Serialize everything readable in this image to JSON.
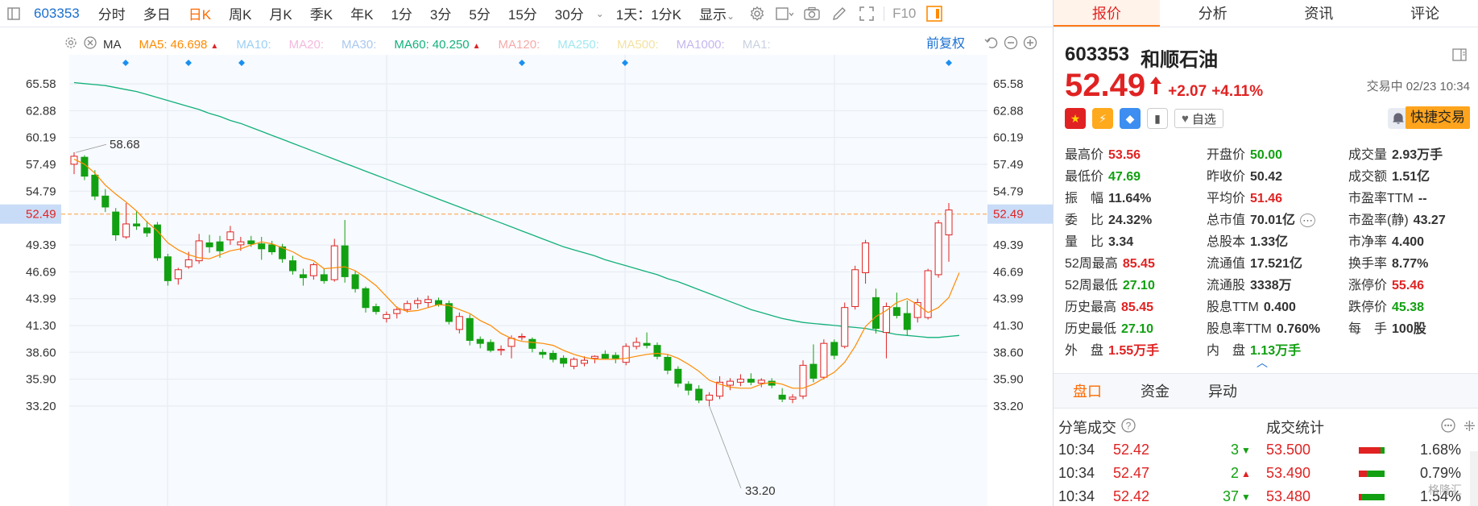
{
  "toolbar": {
    "code": "603353",
    "periods": [
      "分时",
      "多日",
      "日K",
      "周K",
      "月K",
      "季K",
      "年K",
      "1分",
      "3分",
      "5分",
      "15分",
      "30分"
    ],
    "active_period": "日K",
    "range_select": "1天：1分K",
    "display": "显示",
    "f10": "F10"
  },
  "ma_bar": {
    "indicator": "MA",
    "items": [
      {
        "label": "MA5:",
        "value": "46.698",
        "color": "#ff8a00",
        "up": true
      },
      {
        "label": "MA10:",
        "value": "",
        "color": "#9bd0f5",
        "up": false
      },
      {
        "label": "MA20:",
        "value": "",
        "color": "#f5b8de",
        "up": false
      },
      {
        "label": "MA30:",
        "value": "",
        "color": "#a9c8f0",
        "up": false
      },
      {
        "label": "MA60:",
        "value": "40.250",
        "color": "#12b07a",
        "up": true
      },
      {
        "label": "MA120:",
        "value": "",
        "color": "#f7aaaa",
        "up": false
      },
      {
        "label": "MA250:",
        "value": "",
        "color": "#9fe8f0",
        "up": false
      },
      {
        "label": "MA500:",
        "value": "",
        "color": "#f3e2a0",
        "up": false
      },
      {
        "label": "MA1000:",
        "value": "",
        "color": "#c6b6ef",
        "up": false
      },
      {
        "label": "MA1:",
        "value": "",
        "color": "#c8d2e0",
        "up": false
      }
    ],
    "adjust": "前复权"
  },
  "chart_data": {
    "type": "candlestick",
    "y_ticks": [
      65.58,
      62.88,
      60.19,
      57.49,
      54.79,
      52.49,
      49.39,
      46.69,
      43.99,
      41.3,
      38.6,
      35.9,
      33.2
    ],
    "current_price_line": 52.49,
    "high_label": "58.68",
    "low_label": "33.20",
    "candles": [
      {
        "o": 57.5,
        "h": 58.7,
        "l": 56.5,
        "c": 58.3
      },
      {
        "o": 58.2,
        "h": 58.4,
        "l": 55.9,
        "c": 56.3
      },
      {
        "o": 56.4,
        "h": 56.9,
        "l": 53.9,
        "c": 54.3
      },
      {
        "o": 54.3,
        "h": 55.0,
        "l": 52.7,
        "c": 53.2
      },
      {
        "o": 52.7,
        "h": 53.1,
        "l": 49.8,
        "c": 50.4
      },
      {
        "o": 50.2,
        "h": 53.6,
        "l": 50.0,
        "c": 51.5
      },
      {
        "o": 51.5,
        "h": 52.8,
        "l": 50.9,
        "c": 51.3
      },
      {
        "o": 51.1,
        "h": 51.8,
        "l": 50.2,
        "c": 50.6
      },
      {
        "o": 51.4,
        "h": 51.7,
        "l": 47.8,
        "c": 48.1
      },
      {
        "o": 48.2,
        "h": 48.5,
        "l": 45.3,
        "c": 45.8
      },
      {
        "o": 46.0,
        "h": 47.1,
        "l": 45.4,
        "c": 46.9
      },
      {
        "o": 47.2,
        "h": 48.7,
        "l": 47.0,
        "c": 47.9
      },
      {
        "o": 47.8,
        "h": 50.5,
        "l": 47.5,
        "c": 49.8
      },
      {
        "o": 49.6,
        "h": 50.4,
        "l": 48.6,
        "c": 49.2
      },
      {
        "o": 49.7,
        "h": 50.3,
        "l": 48.1,
        "c": 48.8
      },
      {
        "o": 49.9,
        "h": 51.3,
        "l": 49.4,
        "c": 50.7
      },
      {
        "o": 49.4,
        "h": 50.2,
        "l": 48.8,
        "c": 49.7
      },
      {
        "o": 49.8,
        "h": 50.3,
        "l": 49.2,
        "c": 49.5
      },
      {
        "o": 49.5,
        "h": 50.2,
        "l": 47.9,
        "c": 49.0
      },
      {
        "o": 49.4,
        "h": 49.8,
        "l": 48.4,
        "c": 48.7
      },
      {
        "o": 49.2,
        "h": 49.5,
        "l": 47.6,
        "c": 48.0
      },
      {
        "o": 47.8,
        "h": 48.3,
        "l": 46.4,
        "c": 46.8
      },
      {
        "o": 46.4,
        "h": 47.0,
        "l": 45.3,
        "c": 46.1
      },
      {
        "o": 46.3,
        "h": 47.6,
        "l": 45.9,
        "c": 47.4
      },
      {
        "o": 46.4,
        "h": 47.0,
        "l": 45.5,
        "c": 45.8
      },
      {
        "o": 45.9,
        "h": 50.0,
        "l": 45.7,
        "c": 49.3
      },
      {
        "o": 49.3,
        "h": 51.9,
        "l": 45.6,
        "c": 46.2
      },
      {
        "o": 46.4,
        "h": 46.8,
        "l": 44.6,
        "c": 45.0
      },
      {
        "o": 45.0,
        "h": 45.2,
        "l": 42.6,
        "c": 43.1
      },
      {
        "o": 43.2,
        "h": 43.5,
        "l": 42.4,
        "c": 42.7
      },
      {
        "o": 42.0,
        "h": 42.7,
        "l": 41.6,
        "c": 42.4
      },
      {
        "o": 42.5,
        "h": 43.2,
        "l": 42.0,
        "c": 42.9
      },
      {
        "o": 42.9,
        "h": 43.8,
        "l": 42.6,
        "c": 43.5
      },
      {
        "o": 43.5,
        "h": 44.1,
        "l": 43.0,
        "c": 43.8
      },
      {
        "o": 43.6,
        "h": 44.3,
        "l": 43.1,
        "c": 43.9
      },
      {
        "o": 43.8,
        "h": 44.1,
        "l": 43.2,
        "c": 43.4
      },
      {
        "o": 43.5,
        "h": 43.8,
        "l": 41.4,
        "c": 41.7
      },
      {
        "o": 40.9,
        "h": 42.6,
        "l": 40.5,
        "c": 42.2
      },
      {
        "o": 42.0,
        "h": 42.4,
        "l": 39.3,
        "c": 39.8
      },
      {
        "o": 39.9,
        "h": 40.2,
        "l": 39.0,
        "c": 39.5
      },
      {
        "o": 39.6,
        "h": 39.9,
        "l": 38.6,
        "c": 38.8
      },
      {
        "o": 38.8,
        "h": 39.3,
        "l": 38.3,
        "c": 38.9
      },
      {
        "o": 39.2,
        "h": 40.3,
        "l": 38.0,
        "c": 40.0
      },
      {
        "o": 40.1,
        "h": 40.5,
        "l": 39.8,
        "c": 40.2
      },
      {
        "o": 39.9,
        "h": 40.1,
        "l": 38.6,
        "c": 39.0
      },
      {
        "o": 38.6,
        "h": 38.9,
        "l": 38.0,
        "c": 38.4
      },
      {
        "o": 38.5,
        "h": 38.8,
        "l": 37.6,
        "c": 37.9
      },
      {
        "o": 38.0,
        "h": 38.3,
        "l": 37.1,
        "c": 37.5
      },
      {
        "o": 37.2,
        "h": 38.1,
        "l": 36.9,
        "c": 37.9
      },
      {
        "o": 37.5,
        "h": 38.2,
        "l": 37.2,
        "c": 37.8
      },
      {
        "o": 38.0,
        "h": 38.3,
        "l": 37.5,
        "c": 38.2
      },
      {
        "o": 38.4,
        "h": 38.8,
        "l": 37.9,
        "c": 38.0
      },
      {
        "o": 38.3,
        "h": 38.6,
        "l": 37.5,
        "c": 38.0
      },
      {
        "o": 37.6,
        "h": 39.5,
        "l": 37.3,
        "c": 39.2
      },
      {
        "o": 39.2,
        "h": 40.1,
        "l": 38.9,
        "c": 39.6
      },
      {
        "o": 39.5,
        "h": 40.6,
        "l": 39.0,
        "c": 39.3
      },
      {
        "o": 39.3,
        "h": 39.6,
        "l": 37.9,
        "c": 38.2
      },
      {
        "o": 38.1,
        "h": 38.4,
        "l": 36.4,
        "c": 36.8
      },
      {
        "o": 36.9,
        "h": 37.2,
        "l": 35.1,
        "c": 35.5
      },
      {
        "o": 35.4,
        "h": 35.7,
        "l": 34.3,
        "c": 34.8
      },
      {
        "o": 34.9,
        "h": 35.3,
        "l": 33.5,
        "c": 33.8
      },
      {
        "o": 33.8,
        "h": 34.6,
        "l": 33.2,
        "c": 34.3
      },
      {
        "o": 34.2,
        "h": 36.2,
        "l": 33.9,
        "c": 35.6
      },
      {
        "o": 35.3,
        "h": 36.0,
        "l": 34.8,
        "c": 35.7
      },
      {
        "o": 35.6,
        "h": 36.4,
        "l": 35.2,
        "c": 35.9
      },
      {
        "o": 35.9,
        "h": 36.5,
        "l": 35.3,
        "c": 35.6
      },
      {
        "o": 35.5,
        "h": 36.0,
        "l": 35.1,
        "c": 35.8
      },
      {
        "o": 35.7,
        "h": 36.0,
        "l": 35.0,
        "c": 35.3
      },
      {
        "o": 34.3,
        "h": 35.0,
        "l": 33.6,
        "c": 33.9
      },
      {
        "o": 33.9,
        "h": 34.4,
        "l": 33.5,
        "c": 34.1
      },
      {
        "o": 34.2,
        "h": 37.8,
        "l": 33.9,
        "c": 37.3
      },
      {
        "o": 37.4,
        "h": 39.4,
        "l": 35.6,
        "c": 36.0
      },
      {
        "o": 36.1,
        "h": 39.9,
        "l": 35.9,
        "c": 39.5
      },
      {
        "o": 39.6,
        "h": 39.9,
        "l": 37.9,
        "c": 38.3
      },
      {
        "o": 39.2,
        "h": 43.6,
        "l": 39.0,
        "c": 43.1
      },
      {
        "o": 43.2,
        "h": 47.3,
        "l": 42.9,
        "c": 46.9
      },
      {
        "o": 46.6,
        "h": 49.9,
        "l": 45.5,
        "c": 49.6
      },
      {
        "o": 44.1,
        "h": 45.0,
        "l": 40.5,
        "c": 41.0
      },
      {
        "o": 40.6,
        "h": 43.6,
        "l": 38.0,
        "c": 43.2
      },
      {
        "o": 43.1,
        "h": 44.6,
        "l": 42.0,
        "c": 42.3
      },
      {
        "o": 42.5,
        "h": 43.8,
        "l": 40.3,
        "c": 40.9
      },
      {
        "o": 42.1,
        "h": 44.0,
        "l": 41.6,
        "c": 43.6
      },
      {
        "o": 42.1,
        "h": 47.0,
        "l": 41.9,
        "c": 46.8
      },
      {
        "o": 46.4,
        "h": 51.9,
        "l": 46.1,
        "c": 51.6
      },
      {
        "o": 50.4,
        "h": 53.6,
        "l": 47.7,
        "c": 52.9
      }
    ],
    "ma5": [
      58.0,
      57.5,
      56.6,
      55.4,
      54.5,
      53.7,
      52.8,
      51.7,
      50.8,
      49.6,
      48.9,
      48.4,
      48.1,
      48.0,
      48.4,
      48.8,
      49.0,
      49.4,
      49.7,
      49.5,
      49.1,
      48.7,
      48.1,
      47.8,
      47.0,
      47.1,
      47.2,
      46.8,
      46.1,
      45.3,
      44.2,
      43.1,
      42.7,
      42.8,
      43.1,
      43.4,
      43.3,
      42.9,
      42.5,
      41.8,
      41.3,
      40.5,
      40.0,
      39.7,
      39.6,
      39.5,
      39.3,
      38.8,
      38.4,
      38.1,
      37.9,
      37.9,
      37.9,
      38.0,
      38.2,
      38.4,
      38.5,
      38.4,
      38.0,
      37.4,
      36.7,
      35.8,
      35.4,
      35.1,
      35.0,
      35.0,
      35.4,
      35.6,
      35.4,
      35.0,
      35.0,
      35.4,
      36.0,
      36.6,
      37.6,
      39.2,
      41.2,
      42.2,
      42.8,
      43.6,
      44.0,
      43.4,
      42.6,
      43.1,
      44.1,
      46.6
    ],
    "ma60": [
      65.7,
      65.6,
      65.5,
      65.4,
      65.2,
      65.0,
      64.8,
      64.5,
      64.2,
      63.9,
      63.6,
      63.3,
      63.0,
      62.6,
      62.3,
      61.9,
      61.6,
      61.2,
      60.8,
      60.4,
      60.0,
      59.6,
      59.2,
      58.8,
      58.4,
      58.0,
      57.6,
      57.2,
      56.8,
      56.4,
      56.0,
      55.6,
      55.2,
      54.8,
      54.4,
      54.0,
      53.6,
      53.2,
      52.8,
      52.4,
      52.0,
      51.6,
      51.2,
      50.8,
      50.4,
      50.0,
      49.6,
      49.2,
      48.9,
      48.6,
      48.3,
      47.9,
      47.6,
      47.3,
      47.0,
      46.7,
      46.4,
      46.0,
      45.7,
      45.3,
      44.9,
      44.5,
      44.1,
      43.7,
      43.3,
      42.9,
      42.6,
      42.3,
      42.0,
      41.8,
      41.6,
      41.5,
      41.4,
      41.3,
      41.2,
      41.1,
      41.0,
      40.8,
      40.6,
      40.4,
      40.3,
      40.2,
      40.1,
      40.1,
      40.2,
      40.3
    ]
  },
  "quote": {
    "tabs": [
      "报价",
      "分析",
      "资讯",
      "评论"
    ],
    "active_tab": "报价",
    "code": "603353",
    "name": "和顺石油",
    "price": "52.49",
    "change": "+2.07",
    "change_pct": "+4.11%",
    "trade_status": "交易中 02/23 10:34",
    "watch_label": "自选",
    "fast_trade": "快捷交易"
  },
  "stats": [
    [
      {
        "label": "最高价",
        "value": "53.56",
        "color": "red"
      },
      {
        "label": "开盘价",
        "value": "50.00",
        "color": "green"
      },
      {
        "label": "成交量",
        "value": "2.93万手",
        "color": "dark"
      }
    ],
    [
      {
        "label": "最低价",
        "value": "47.69",
        "color": "green"
      },
      {
        "label": "昨收价",
        "value": "50.42",
        "color": "dark"
      },
      {
        "label": "成交额",
        "value": "1.51亿",
        "color": "dark"
      }
    ],
    [
      {
        "label": "振　幅",
        "value": "11.64%",
        "color": "dark"
      },
      {
        "label": "平均价",
        "value": "51.46",
        "color": "red"
      },
      {
        "label": "市盈率TTM",
        "value": "--",
        "color": "dark"
      }
    ],
    [
      {
        "label": "委　比",
        "value": "24.32%",
        "color": "dark"
      },
      {
        "label": "总市值",
        "value": "70.01亿",
        "color": "dark"
      },
      {
        "label": "市盈率(静)",
        "value": "43.27",
        "color": "dark"
      }
    ],
    [
      {
        "label": "量　比",
        "value": "3.34",
        "color": "dark"
      },
      {
        "label": "总股本",
        "value": "1.33亿",
        "color": "dark"
      },
      {
        "label": "市净率",
        "value": "4.400",
        "color": "dark"
      }
    ],
    [
      {
        "label": "52周最高",
        "value": "85.45",
        "color": "red"
      },
      {
        "label": "流通值",
        "value": "17.521亿",
        "color": "dark"
      },
      {
        "label": "换手率",
        "value": "8.77%",
        "color": "dark"
      }
    ],
    [
      {
        "label": "52周最低",
        "value": "27.10",
        "color": "green"
      },
      {
        "label": "流通股",
        "value": "3338万",
        "color": "dark"
      },
      {
        "label": "涨停价",
        "value": "55.46",
        "color": "red"
      }
    ],
    [
      {
        "label": "历史最高",
        "value": "85.45",
        "color": "red"
      },
      {
        "label": "股息TTM",
        "value": "0.400",
        "color": "dark"
      },
      {
        "label": "跌停价",
        "value": "45.38",
        "color": "green"
      }
    ],
    [
      {
        "label": "历史最低",
        "value": "27.10",
        "color": "green"
      },
      {
        "label": "股息率TTM",
        "value": "0.760%",
        "color": "dark"
      },
      {
        "label": "每　手",
        "value": "100股",
        "color": "dark"
      }
    ],
    [
      {
        "label": "外　盘",
        "value": "1.55万手",
        "color": "red"
      },
      {
        "label": "内　盘",
        "value": "1.13万手",
        "color": "green"
      },
      {
        "label": "",
        "value": "",
        "color": "dark"
      }
    ]
  ],
  "subtabs": [
    "盘口",
    "资金",
    "异动"
  ],
  "active_subtab": "盘口",
  "ticks": {
    "title": "分笔成交",
    "rows": [
      {
        "time": "10:34",
        "price": "52.42",
        "vol": "3",
        "dir": "down"
      },
      {
        "time": "10:34",
        "price": "52.47",
        "vol": "2",
        "dir": "up"
      },
      {
        "time": "10:34",
        "price": "52.42",
        "vol": "37",
        "dir": "down"
      }
    ]
  },
  "volume_stats": {
    "title": "成交统计",
    "rows": [
      {
        "price": "53.500",
        "pct": "1.68%",
        "buy": 0.85
      },
      {
        "price": "53.490",
        "pct": "0.79%",
        "buy": 0.3
      },
      {
        "price": "53.480",
        "pct": "1.54%",
        "buy": 0.1
      }
    ]
  },
  "watermark": "格隆汇",
  "colors": {
    "up": "#e02222",
    "down": "#12a012",
    "accent": "#ff6a00",
    "link": "#1a6fd1"
  }
}
